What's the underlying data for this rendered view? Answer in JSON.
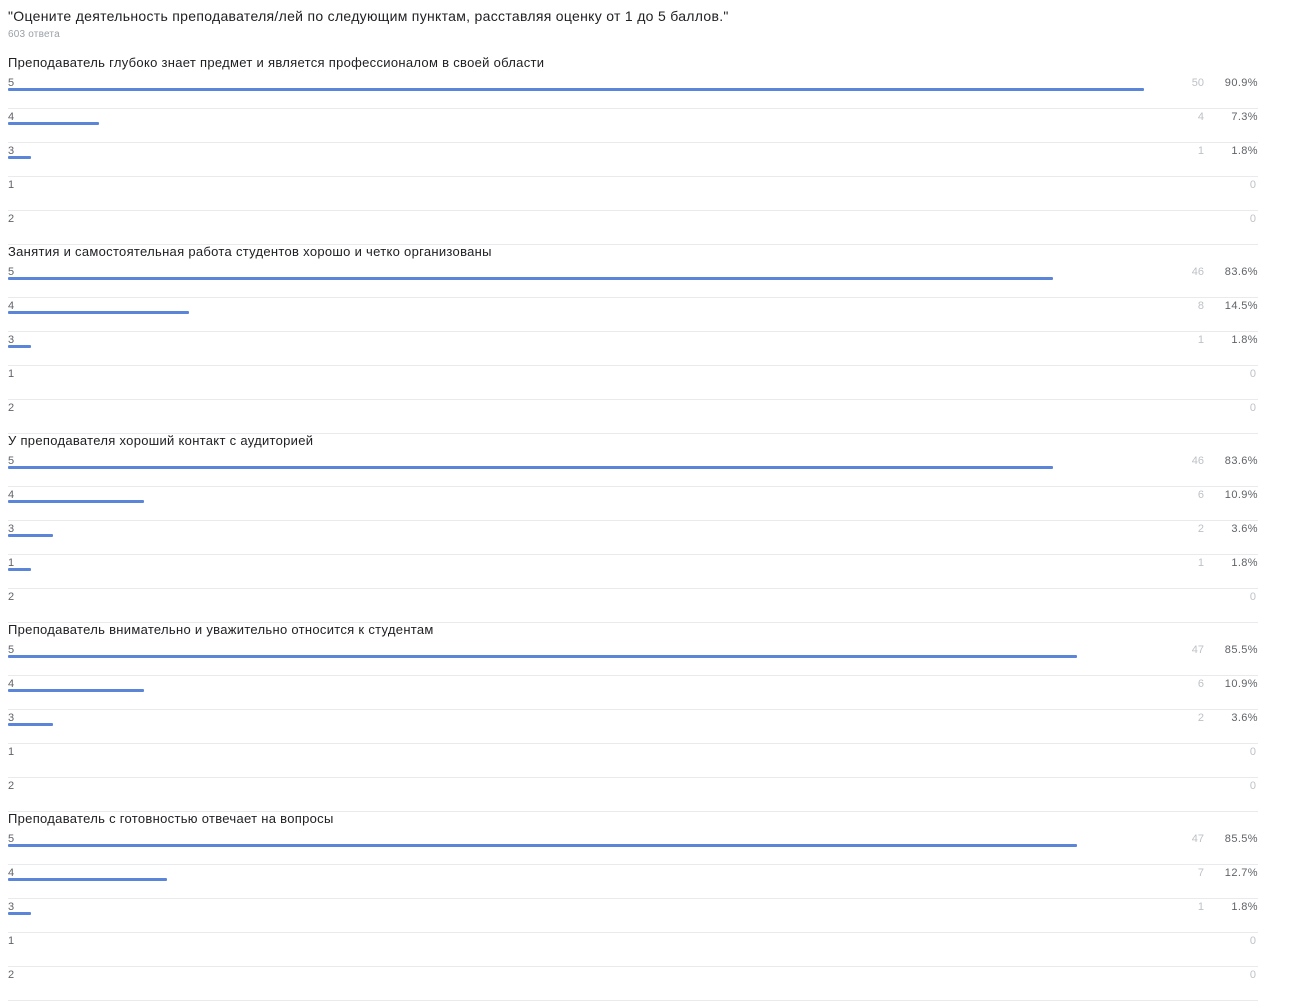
{
  "header": {
    "title": "\"Оцените деятельность преподавателя/лей по следующим пунктам, расставляя оценку от 1 до 5 баллов.\"",
    "subtitle": "603 ответа"
  },
  "colors": {
    "bar": "#5b85d9",
    "divider": "#e8eaed",
    "muted_text": "#9aa0a6"
  },
  "chart_data": [
    {
      "type": "bar",
      "orientation": "horizontal",
      "title": "Преподаватель глубоко знает предмет и является профессионалом в своей области",
      "categories": [
        "5",
        "4",
        "3",
        "1",
        "2"
      ],
      "counts": [
        50,
        4,
        1,
        0,
        0
      ],
      "percents": [
        "90.9%",
        "7.3%",
        "1.8%",
        "",
        ""
      ],
      "values": [
        90.9,
        7.3,
        1.8,
        0,
        0
      ]
    },
    {
      "type": "bar",
      "orientation": "horizontal",
      "title": "Занятия и самостоятельная работа студентов хорошо и четко организованы",
      "categories": [
        "5",
        "4",
        "3",
        "1",
        "2"
      ],
      "counts": [
        46,
        8,
        1,
        0,
        0
      ],
      "percents": [
        "83.6%",
        "14.5%",
        "1.8%",
        "",
        ""
      ],
      "values": [
        83.6,
        14.5,
        1.8,
        0,
        0
      ]
    },
    {
      "type": "bar",
      "orientation": "horizontal",
      "title": "У преподавателя хороший контакт с аудиторией",
      "categories": [
        "5",
        "4",
        "3",
        "1",
        "2"
      ],
      "counts": [
        46,
        6,
        2,
        1,
        0
      ],
      "percents": [
        "83.6%",
        "10.9%",
        "3.6%",
        "1.8%",
        ""
      ],
      "values": [
        83.6,
        10.9,
        3.6,
        1.8,
        0
      ]
    },
    {
      "type": "bar",
      "orientation": "horizontal",
      "title": "Преподаватель внимательно и уважительно относится к студентам",
      "categories": [
        "5",
        "4",
        "3",
        "1",
        "2"
      ],
      "counts": [
        47,
        6,
        2,
        0,
        0
      ],
      "percents": [
        "85.5%",
        "10.9%",
        "3.6%",
        "",
        ""
      ],
      "values": [
        85.5,
        10.9,
        3.6,
        0,
        0
      ]
    },
    {
      "type": "bar",
      "orientation": "horizontal",
      "title": "Преподаватель с готовностью отвечает на вопросы",
      "categories": [
        "5",
        "4",
        "3",
        "1",
        "2"
      ],
      "counts": [
        47,
        7,
        1,
        0,
        0
      ],
      "percents": [
        "85.5%",
        "12.7%",
        "1.8%",
        "",
        ""
      ],
      "values": [
        85.5,
        12.7,
        1.8,
        0,
        0
      ]
    }
  ]
}
